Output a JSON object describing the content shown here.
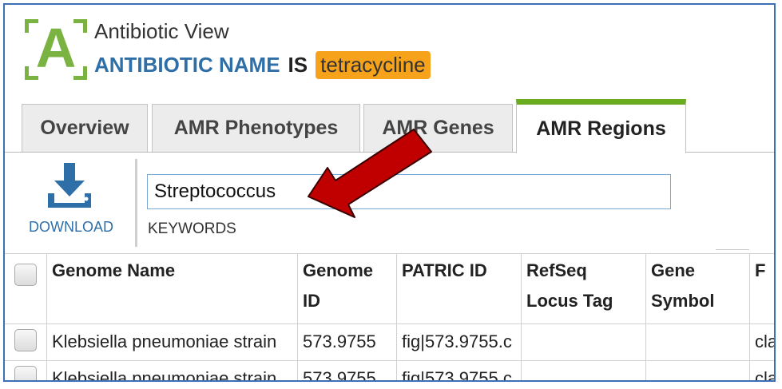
{
  "header": {
    "logo_letter": "A",
    "view_title": "Antibiotic View",
    "name_key": "ANTIBIOTIC NAME",
    "name_operator": "IS",
    "name_value": "tetracycline"
  },
  "tabs": [
    {
      "label": "Overview",
      "active": false
    },
    {
      "label": "AMR Phenotypes",
      "active": false
    },
    {
      "label": "AMR Genes",
      "active": false
    },
    {
      "label": "AMR Regions",
      "active": true
    }
  ],
  "toolbar": {
    "download_label": "DOWNLOAD",
    "download_icon": "download-icon",
    "search_value": "Streptococcus",
    "keywords_label": "KEYWORDS"
  },
  "table": {
    "columns": [
      "Genome Name",
      "Genome ID",
      "PATRIC ID",
      "RefSeq Locus Tag",
      "Gene Symbol",
      "F"
    ],
    "rows": [
      [
        "Klebsiella pneumoniae strain",
        "573.9755",
        "fig|573.9755.c",
        "",
        "",
        "cla"
      ],
      [
        "Klebsiella pneumoniae strain",
        "573.9755",
        "fig|573.9755.c",
        "",
        "",
        "cla"
      ]
    ]
  },
  "colors": {
    "accent_green": "#6aab1f",
    "logo_green": "#7bb342",
    "link_blue": "#2f6fa8",
    "highlight_orange": "#f7a21b",
    "arrow_red": "#c00000"
  }
}
